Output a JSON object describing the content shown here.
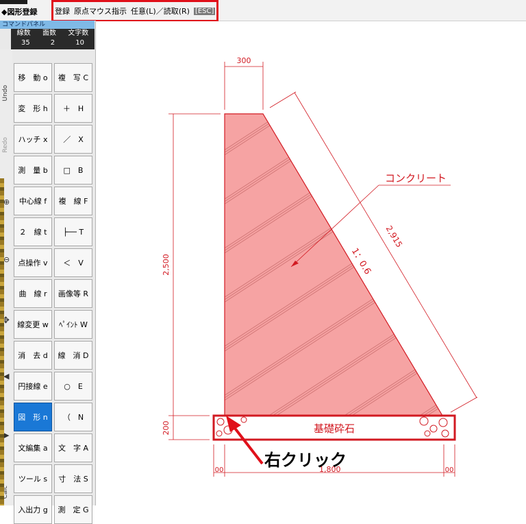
{
  "app": {
    "title": "◆図形登録"
  },
  "command_bar": {
    "register": "登録",
    "origin": "原点マウス指示",
    "arbitrary": "任意(L)／読取(R)",
    "esc": "[ESC]"
  },
  "panel": {
    "title": "コマンドパネル",
    "stats_headers": [
      "線数",
      "面数",
      "文字数"
    ],
    "stats_values": [
      "35",
      "2",
      "10"
    ]
  },
  "side_labels": {
    "undo": "Undo",
    "redo": "Redo",
    "calc": "Calc"
  },
  "commands": [
    [
      "移　動 o",
      "複　写 C"
    ],
    [
      "変　形 h",
      "＋　H"
    ],
    [
      "ハッチ x",
      "／　X"
    ],
    [
      "測　量 b",
      "□　B"
    ],
    [
      "中心線 f",
      "複　線 F"
    ],
    [
      "２　線 t",
      "├── T"
    ],
    [
      "点操作 v",
      "＜　V"
    ],
    [
      "曲　線 r",
      "画像等 R"
    ],
    [
      "線変更 w",
      "ﾍﾟｲﾝﾄ W"
    ],
    [
      "消　去 d",
      "線　消 D"
    ],
    [
      "円接線 e",
      "○　E"
    ],
    [
      "図　形 n",
      "（　N"
    ],
    [
      "文編集 a",
      "文　字 A"
    ],
    [
      "ツール s",
      "寸　法 S"
    ],
    [
      "入出力 g",
      "測　定 G"
    ]
  ],
  "drawing": {
    "dim_top": "300",
    "dim_height": "2,500",
    "dim_slope": "2,915",
    "dim_base_height": "200",
    "dim_base_width": "1,800",
    "dim_left_offset": "00",
    "dim_right_offset": "00",
    "slope_ratio": "1：0.6",
    "concrete_label": "コンクリート",
    "base_label": "基礎砕石",
    "right_click_label": "右クリック"
  },
  "colors": {
    "accent_red": "#e0101a",
    "fill_pink": "#f6a3a3",
    "dim_red": "#d21a22",
    "active_blue": "#1a78d6"
  }
}
